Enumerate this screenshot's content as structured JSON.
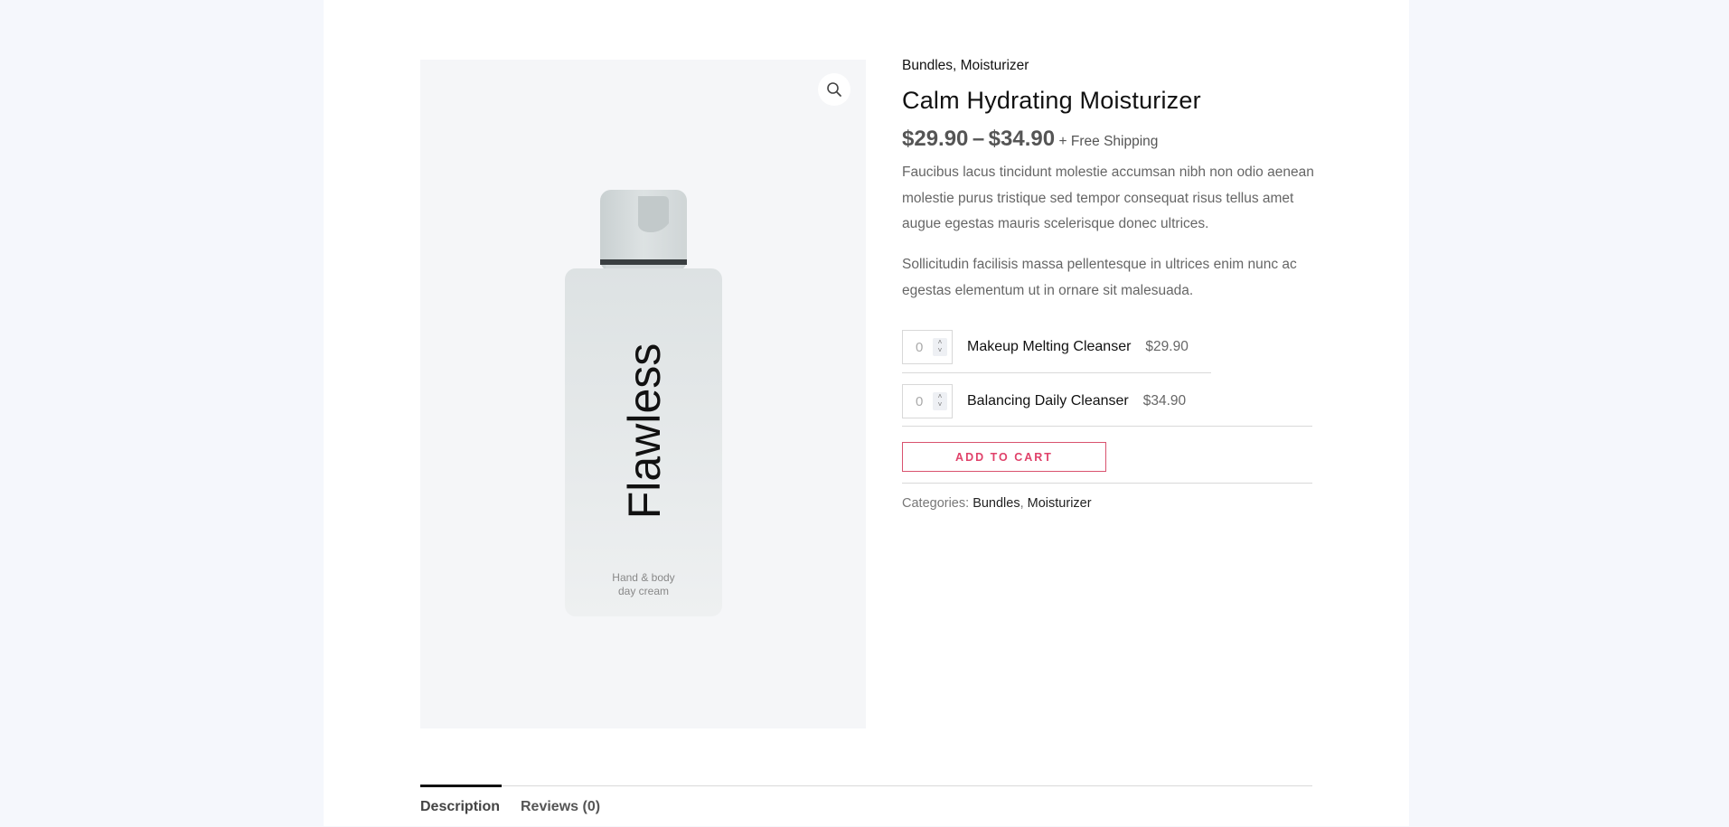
{
  "product": {
    "categories_top": [
      "Bundles",
      "Moisturizer"
    ],
    "category_separator": ", ",
    "title": "Calm Hydrating Moisturizer",
    "price_low": "$29.90",
    "price_sep": "–",
    "price_high": "$34.90",
    "shipping_note": "+ Free Shipping",
    "description_1": "Faucibus lacus tincidunt molestie accumsan nibh non odio aenean molestie purus tristique sed tempor consequat risus tellus amet augue egestas mauris scelerisque donec ultrices.",
    "description_2": "Sollicitudin facilisis massa pellentesque in ultrices enim nunc ac egestas elementum ut in ornare sit malesuada.",
    "image": {
      "brand_text": "Flawless",
      "sub_line1": "Hand & body",
      "sub_line2": "day cream",
      "zoom_icon": "magnifier-icon"
    }
  },
  "grouped_items": [
    {
      "qty": "0",
      "name": "Makeup Melting Cleanser",
      "price": "$29.90"
    },
    {
      "qty": "0",
      "name": "Balancing Daily Cleanser",
      "price": "$34.90"
    }
  ],
  "cart": {
    "add_label": "ADD TO CART"
  },
  "meta": {
    "categories_label": "Categories:",
    "cat_1": "Bundles",
    "cat_sep": ",",
    "cat_2": "Moisturizer"
  },
  "tabs": [
    {
      "label": "Description",
      "active": true
    },
    {
      "label": "Reviews (0)",
      "active": false
    }
  ],
  "colors": {
    "background": "#f5f7fc",
    "accent": "#e0426a",
    "text_dark": "#111111",
    "text_body": "#666666"
  }
}
